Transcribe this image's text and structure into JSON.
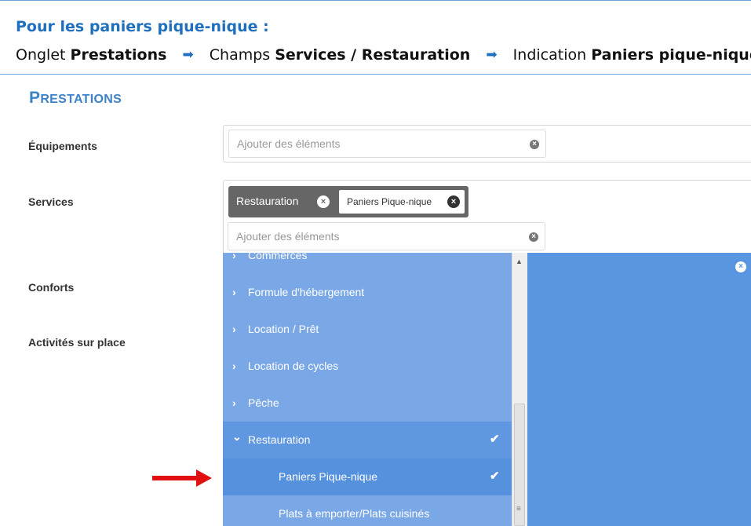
{
  "instruction": {
    "title": "Pour les paniers pique-nique :",
    "steps": [
      {
        "prefix": "Onglet",
        "bold": "Prestations"
      },
      {
        "prefix": "Champs",
        "bold": "Services / Restauration"
      },
      {
        "prefix": "Indication",
        "bold": "Paniers pique-nique"
      }
    ]
  },
  "section": {
    "title_first": "P",
    "title_rest": "RESTATIONS"
  },
  "fields": {
    "equipements": {
      "label": "Équipements",
      "placeholder": "Ajouter des éléments"
    },
    "services": {
      "label": "Services",
      "placeholder": "Ajouter des éléments",
      "tags": [
        {
          "label": "Restauration"
        },
        {
          "label": "Paniers Pique-nique"
        }
      ]
    },
    "conforts": {
      "label": "Conforts"
    },
    "activites": {
      "label": "Activités sur place"
    }
  },
  "dropdown": {
    "items": [
      {
        "label": "Commerces",
        "chevron": "›",
        "checked": false
      },
      {
        "label": "Formule d'hébergement",
        "chevron": "›",
        "checked": false
      },
      {
        "label": "Location / Prêt",
        "chevron": "›",
        "checked": false
      },
      {
        "label": "Location de cycles",
        "chevron": "›",
        "checked": false
      },
      {
        "label": "Pêche",
        "chevron": "›",
        "checked": false
      },
      {
        "label": "Restauration",
        "chevron": "⌄",
        "checked": true
      },
      {
        "label": "Paniers Pique-nique",
        "sub": true,
        "checked": true
      },
      {
        "label": "Plats à emporter/Plats cuisinés",
        "sub": true,
        "checked": false
      }
    ]
  },
  "icons": {
    "clear": "×",
    "check": "✔",
    "arrow_right": "➡",
    "scroll_up": "▲",
    "scroll_grip": "≡"
  },
  "colors": {
    "accent": "#1f6fbf",
    "section_title": "#3c82c8",
    "dropdown_bg": "#7aa8e6",
    "dropdown_selected": "#5f97e0",
    "panel_bg": "#5a96e0",
    "tag_dark": "#666666",
    "pointer_arrow": "#e01010"
  }
}
